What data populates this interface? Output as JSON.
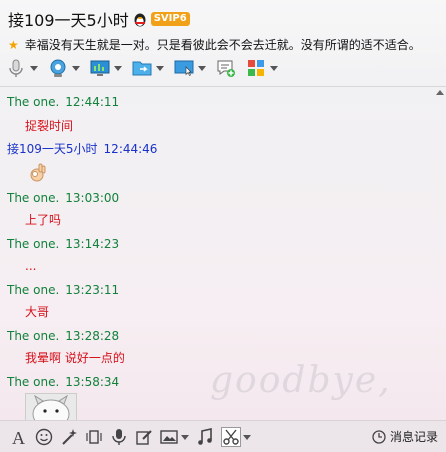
{
  "header": {
    "title": "接109一天5小时",
    "vip_label": "SVIP6",
    "signature": "幸福没有天生就是一对。只是看彼此会不会去迁就。没有所谓的适不适合。"
  },
  "toolbar": {
    "items": [
      {
        "icon": "microphone-icon"
      },
      {
        "icon": "webcam-icon"
      },
      {
        "icon": "remote-assist-icon"
      },
      {
        "icon": "file-transfer-icon"
      },
      {
        "icon": "screen-share-icon"
      },
      {
        "icon": "add-chat-icon"
      },
      {
        "icon": "apps-grid-icon"
      }
    ]
  },
  "messages": [
    {
      "sender": "The one.",
      "time": "12:44:11",
      "text": "捉裂时间",
      "side": "other"
    },
    {
      "sender": "接109一天5小时",
      "time": "12:44:46",
      "text": "",
      "emoji": "ok-hand-icon",
      "side": "me"
    },
    {
      "sender": "The one.",
      "time": "13:03:00",
      "text": "上了吗",
      "side": "other"
    },
    {
      "sender": "The one.",
      "time": "13:14:23",
      "text": "...",
      "side": "other"
    },
    {
      "sender": "The one.",
      "time": "13:23:11",
      "text": "大哥",
      "side": "other"
    },
    {
      "sender": "The one.",
      "time": "13:28:28",
      "text": "我晕啊 说好一点的",
      "side": "other"
    },
    {
      "sender": "The one.",
      "time": "13:58:34",
      "text": "",
      "side": "other"
    }
  ],
  "watermark": "goodbye,",
  "bottom_bar": {
    "history_label": "消息记录"
  },
  "colors": {
    "other_name": "#11813b",
    "me_name": "#1a32c9",
    "message_text": "#d6101a"
  }
}
